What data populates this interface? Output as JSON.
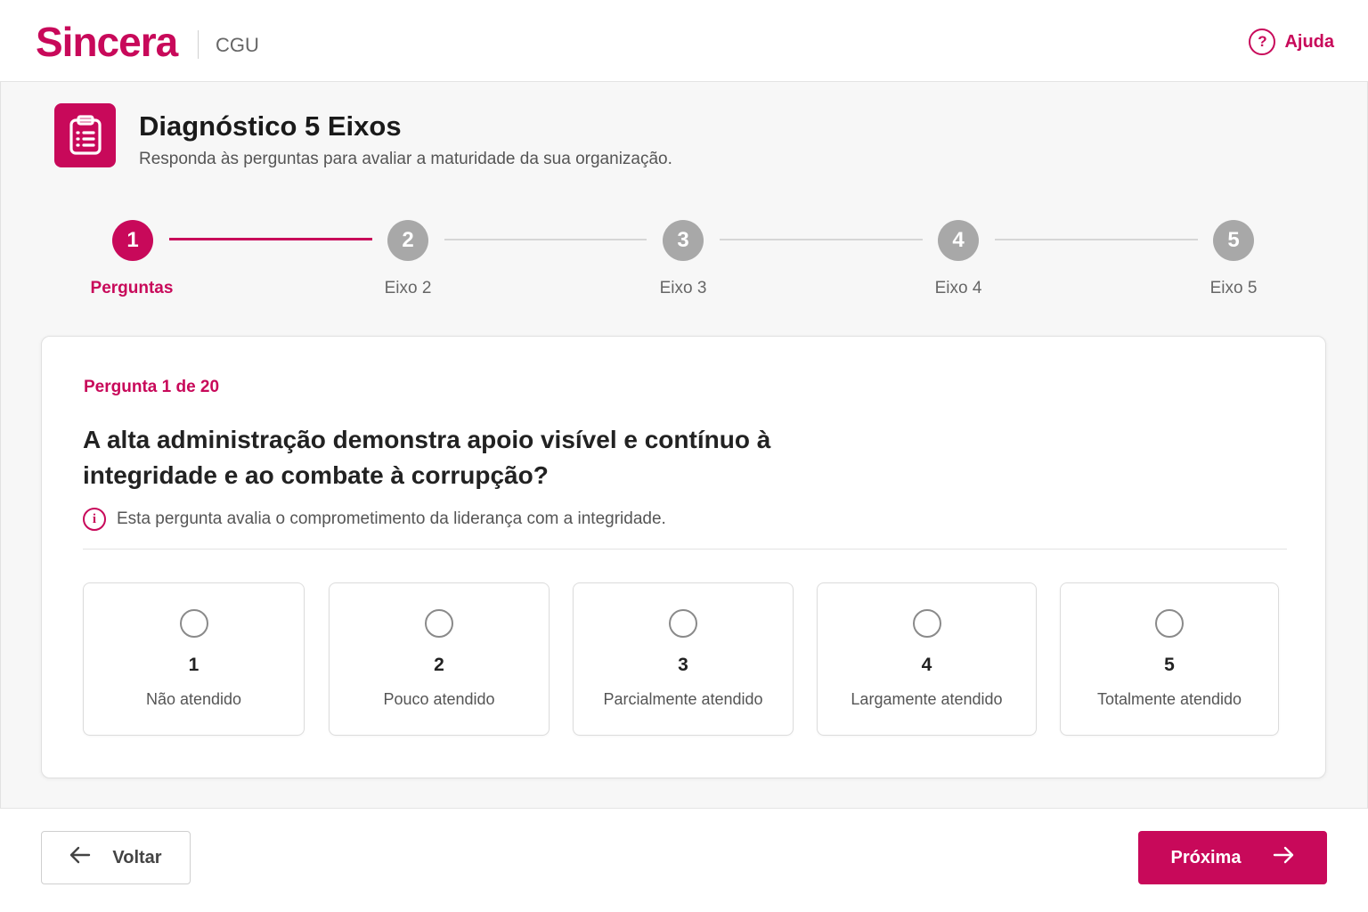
{
  "app": {
    "brand": "Sincera",
    "org": "CGU",
    "help_label": "Ajuda"
  },
  "page": {
    "title": "Diagnóstico 5 Eixos",
    "subtitle": "Responda às perguntas para avaliar a maturidade da sua organização."
  },
  "stepper": {
    "steps": [
      {
        "number": "1",
        "label": "Perguntas",
        "state": "active"
      },
      {
        "number": "2",
        "label": "Eixo 2",
        "state": "pending"
      },
      {
        "number": "3",
        "label": "Eixo 3",
        "state": "pending"
      },
      {
        "number": "4",
        "label": "Eixo 4",
        "state": "pending"
      },
      {
        "number": "5",
        "label": "Eixo 5",
        "state": "pending"
      }
    ]
  },
  "question": {
    "counter": "Pergunta 1 de 20",
    "text": "A alta administração demonstra apoio visível e contínuo à integridade e ao combate à corrupção?",
    "hint": "Esta pergunta avalia o comprometimento da liderança com a integridade."
  },
  "options": [
    {
      "value": "1",
      "label": "Não atendido"
    },
    {
      "value": "2",
      "label": "Pouco atendido"
    },
    {
      "value": "3",
      "label": "Parcialmente atendido"
    },
    {
      "value": "4",
      "label": "Largamente atendido"
    },
    {
      "value": "5",
      "label": "Totalmente atendido"
    }
  ],
  "footer": {
    "back_label": "Voltar",
    "next_label": "Próxima"
  },
  "colors": {
    "accent": "#c8095a",
    "inactive_step": "#a8a8a8"
  }
}
